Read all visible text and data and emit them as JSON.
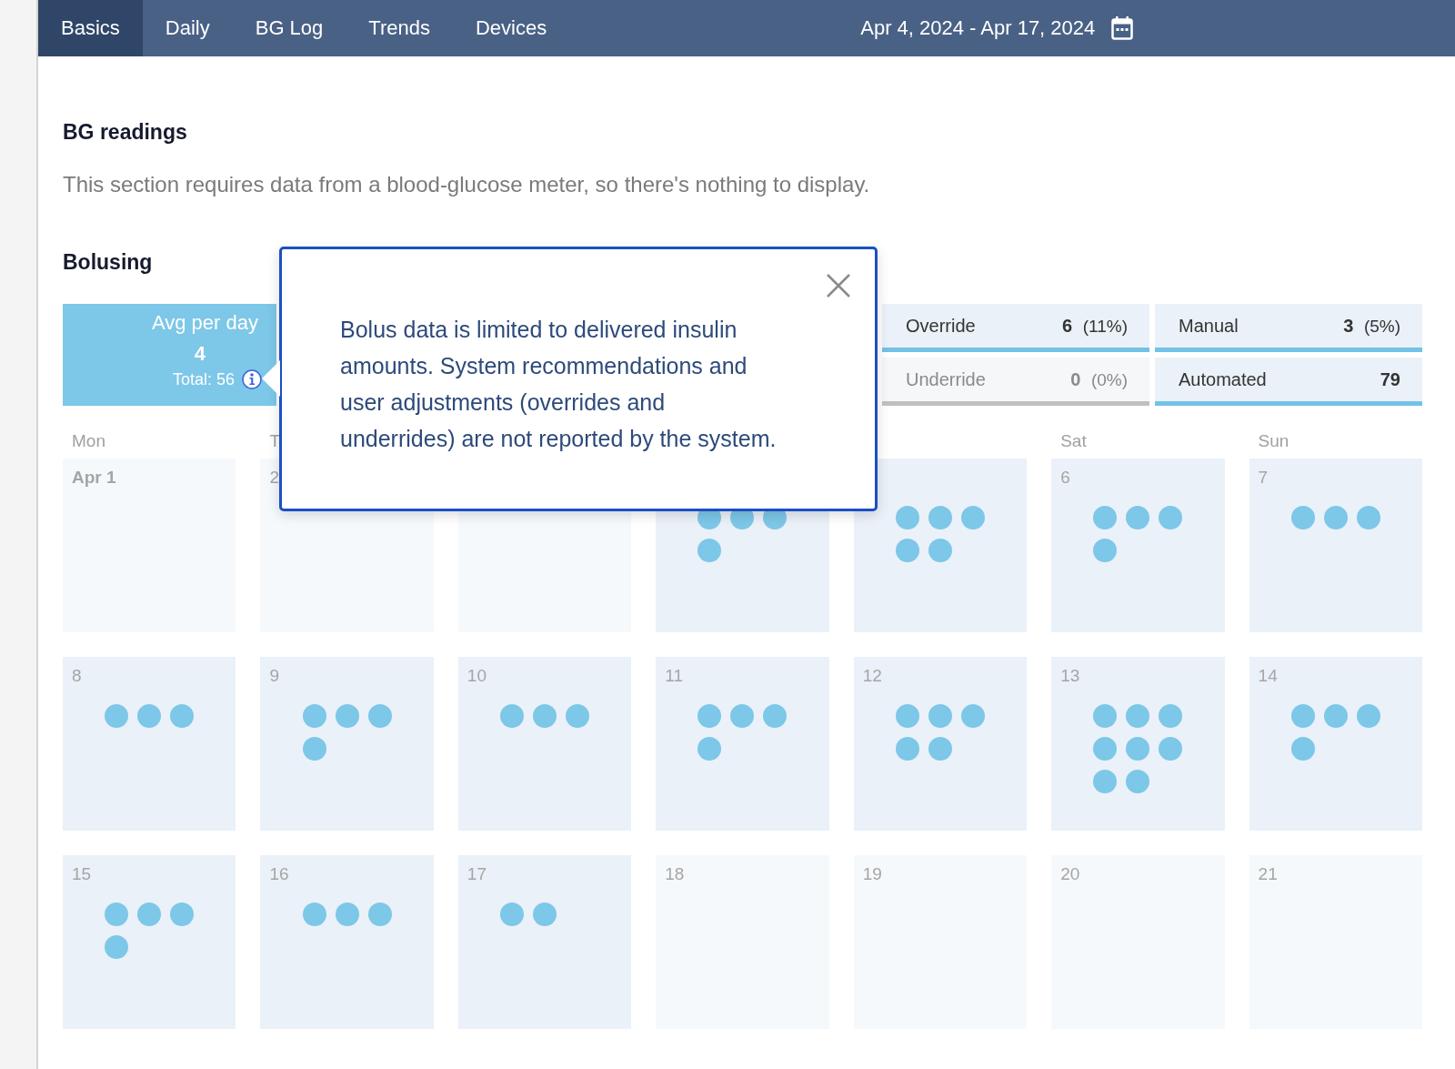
{
  "nav": {
    "tabs": [
      {
        "label": "Basics",
        "selected": true
      },
      {
        "label": "Daily",
        "selected": false
      },
      {
        "label": "BG Log",
        "selected": false
      },
      {
        "label": "Trends",
        "selected": false
      },
      {
        "label": "Devices",
        "selected": false
      }
    ],
    "date_range": "Apr 4, 2024 - Apr 17, 2024"
  },
  "bg_readings": {
    "title": "BG readings",
    "message": "This section requires data from a blood-glucose meter, so there's nothing to display."
  },
  "bolusing": {
    "title": "Bolusing",
    "avg": {
      "label": "Avg per day",
      "value": "4",
      "total": "Total: 56"
    },
    "stats": [
      {
        "label": "Override",
        "value": "6",
        "percent": "(11%)",
        "disabled": false
      },
      {
        "label": "Manual",
        "value": "3",
        "percent": "(5%)",
        "disabled": false
      },
      {
        "label": "Underride",
        "value": "0",
        "percent": "(0%)",
        "disabled": true
      },
      {
        "label": "Automated",
        "value": "79",
        "disabled": false
      }
    ],
    "days": [
      {
        "weekday": "Mon",
        "label": "Apr 1",
        "in_range": false
      },
      {
        "weekday": "T",
        "label": "2",
        "in_range": false
      },
      {
        "in_range": false
      },
      {
        "in_range": true,
        "boluses": [
          {
            "kind": "bolus"
          },
          {
            "kind": "bolus"
          },
          {
            "kind": "bolus"
          },
          {
            "kind": "bolus"
          }
        ]
      },
      {
        "in_range": true,
        "boluses": [
          {
            "kind": "bolus"
          },
          {
            "kind": "bolus"
          },
          {
            "kind": "bolus"
          },
          {
            "kind": "bolus"
          },
          {
            "kind": "bolus"
          }
        ]
      },
      {
        "weekday": "Sat",
        "label": "6",
        "in_range": true,
        "boluses": [
          {
            "kind": "bolus"
          },
          {
            "kind": "bolus"
          },
          {
            "kind": "bolus"
          },
          {
            "kind": "bolus"
          }
        ]
      },
      {
        "weekday": "Sun",
        "label": "7",
        "in_range": true,
        "boluses": [
          {
            "kind": "bolus"
          },
          {
            "kind": "bolus"
          },
          {
            "kind": "bolus"
          }
        ]
      },
      {
        "label": "8",
        "in_range": true,
        "boluses": [
          {
            "kind": "bolus"
          },
          {
            "kind": "bolus"
          },
          {
            "kind": "bolus"
          }
        ]
      },
      {
        "label": "9",
        "in_range": true,
        "boluses": [
          {
            "kind": "bolus"
          },
          {
            "kind": "bolus"
          },
          {
            "kind": "bolus"
          },
          {
            "kind": "bolus"
          }
        ]
      },
      {
        "label": "10",
        "in_range": true,
        "boluses": [
          {
            "kind": "bolus"
          },
          {
            "kind": "bolus"
          },
          {
            "kind": "bolus"
          }
        ]
      },
      {
        "label": "11",
        "in_range": true,
        "boluses": [
          {
            "kind": "bolus"
          },
          {
            "kind": "bolus"
          },
          {
            "kind": "bolus"
          },
          {
            "kind": "bolus"
          }
        ]
      },
      {
        "label": "12",
        "in_range": true,
        "boluses": [
          {
            "kind": "bolus"
          },
          {
            "kind": "bolus"
          },
          {
            "kind": "bolus"
          },
          {
            "kind": "bolus"
          },
          {
            "kind": "bolus"
          }
        ]
      },
      {
        "label": "13",
        "in_range": true,
        "boluses": [
          {
            "kind": "bolus"
          },
          {
            "kind": "bolus"
          },
          {
            "kind": "bolus"
          },
          {
            "kind": "bolus"
          },
          {
            "kind": "bolus"
          },
          {
            "kind": "bolus"
          },
          {
            "kind": "bolus"
          },
          {
            "kind": "bolus"
          }
        ]
      },
      {
        "label": "14",
        "in_range": true,
        "boluses": [
          {
            "kind": "bolus"
          },
          {
            "kind": "bolus"
          },
          {
            "kind": "bolus"
          },
          {
            "kind": "bolus"
          }
        ]
      },
      {
        "label": "15",
        "in_range": true,
        "boluses": [
          {
            "kind": "bolus"
          },
          {
            "kind": "bolus"
          },
          {
            "kind": "bolus"
          },
          {
            "kind": "bolus"
          }
        ]
      },
      {
        "label": "16",
        "in_range": true,
        "boluses": [
          {
            "kind": "bolus"
          },
          {
            "kind": "bolus"
          },
          {
            "kind": "bolus"
          }
        ]
      },
      {
        "label": "17",
        "in_range": true,
        "boluses": [
          {
            "kind": "bolus"
          },
          {
            "kind": "bolus"
          }
        ]
      },
      {
        "label": "18",
        "in_range": false
      },
      {
        "label": "19",
        "in_range": false
      },
      {
        "label": "20",
        "in_range": false
      },
      {
        "label": "21",
        "in_range": false
      }
    ],
    "tooltip": {
      "text": "Bolus data is limited to delivered insulin amounts. System recommendations and user adjustments (overrides and underrides) are not reported by the system."
    }
  }
}
